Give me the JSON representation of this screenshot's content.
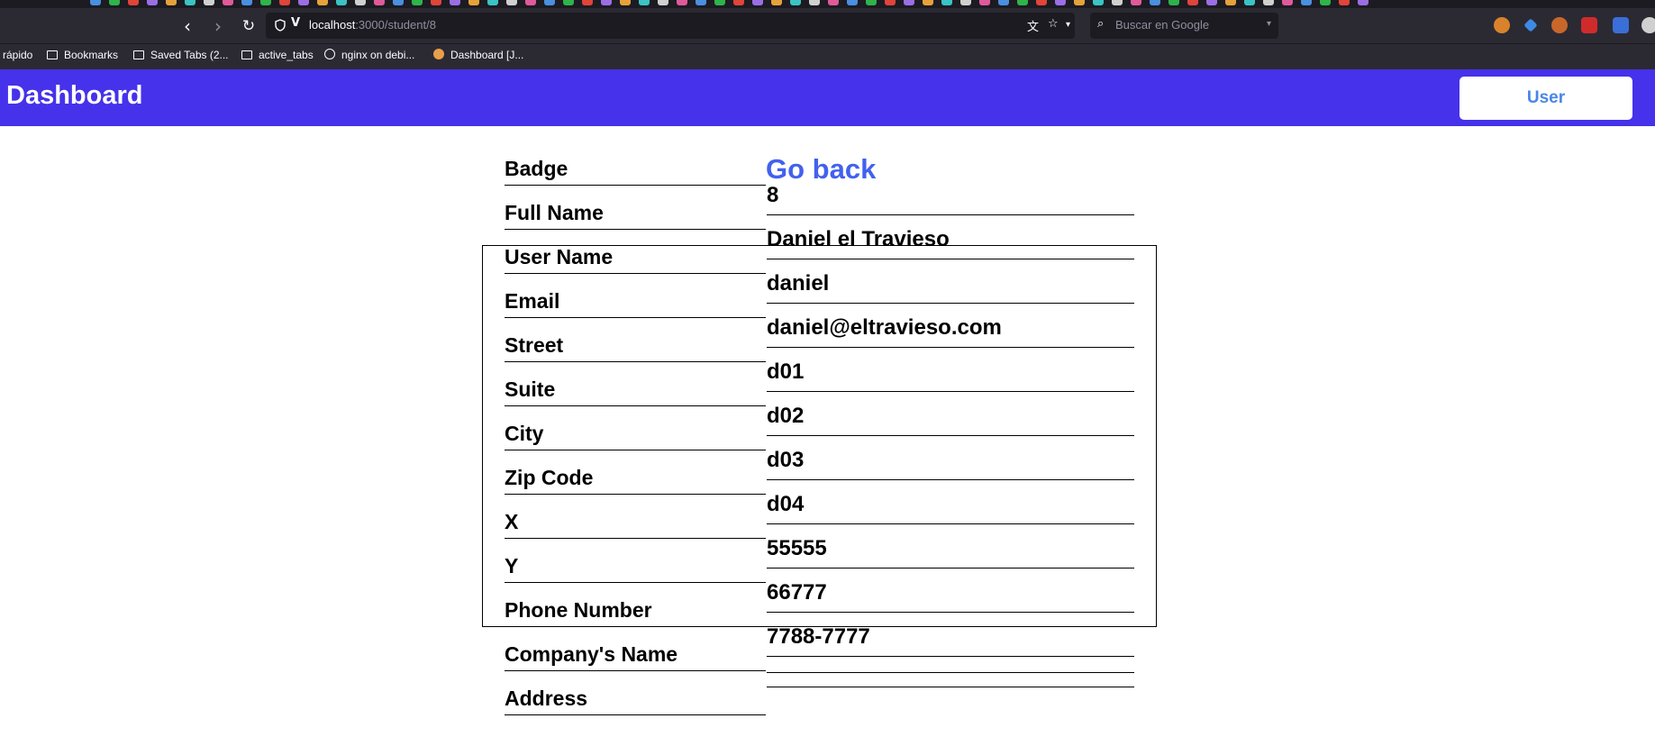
{
  "browser": {
    "url_host": "localhost",
    "url_path": ":3000/student/8",
    "search_placeholder": "Buscar en Google",
    "bookmarks": [
      {
        "label": "rápido",
        "icon": "none"
      },
      {
        "label": "Bookmarks",
        "icon": "folder-icon"
      },
      {
        "label": "Saved Tabs (2...",
        "icon": "folder-icon"
      },
      {
        "label": "active_tabs",
        "icon": "folder-icon"
      },
      {
        "label": "nginx on debi...",
        "icon": "globe-icon"
      },
      {
        "label": "Dashboard [J...",
        "icon": "favicon"
      }
    ]
  },
  "app": {
    "title": "Dashboard",
    "user_button": "User",
    "header_color": "#4532ea"
  },
  "form": {
    "go_back": "Go back",
    "labels": [
      "Badge",
      "Full Name",
      "User Name",
      "Email",
      "Street",
      "Suite",
      "City",
      "Zip Code",
      "X",
      "Y",
      "Phone Number",
      "Company's Name",
      "Address"
    ],
    "values": [
      "8",
      "Daniel el Travieso",
      "daniel",
      "daniel@eltravieso.com",
      "d01",
      "d02",
      "d03",
      "d04",
      "55555",
      "66777",
      "7788-7777",
      "",
      ""
    ]
  }
}
